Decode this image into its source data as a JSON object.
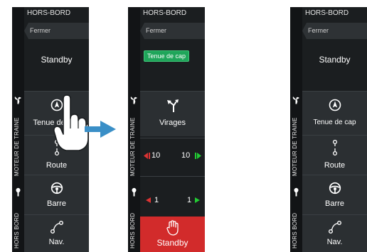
{
  "colors": {
    "accent_green": "#1fa55a",
    "stop_red": "#d22b2b",
    "arrow_blue": "#3a8fc7"
  },
  "panel1": {
    "title": "HORS-BORD",
    "close_label": "Fermer",
    "mode": "Standby",
    "rail_sections": [
      "MOTEUR DE TRAINE",
      "HORS BORD"
    ],
    "tiles": [
      {
        "label": "Tenue de cap",
        "icon": "compass-icon"
      },
      {
        "label": "Route",
        "icon": "route-icon"
      },
      {
        "label": "Barre",
        "icon": "steering-wheel-icon"
      },
      {
        "label": "Nav.",
        "icon": "nav-icon"
      }
    ],
    "overlay_icon": "pointing-hand-icon"
  },
  "panel2": {
    "title": "HORS-BORD",
    "close_label": "Fermer",
    "active_mode": "Tenue de cap",
    "rail_sections": [
      "MOTEUR DE TRAINE",
      "HORS BORD"
    ],
    "turns_label": "Virages",
    "turns_icon": "turn-arrows-icon",
    "port_10": "10",
    "stbd_10": "10",
    "port_1": "1",
    "stbd_1": "1",
    "standby_label": "Standby",
    "standby_icon": "hand-stop-icon"
  },
  "panel3": {
    "title": "HORS-BORD",
    "close_label": "Fermer",
    "mode": "Standby",
    "rail_sections": [
      "MOTEUR DE TRAINE",
      "HORS BORD"
    ],
    "tiles": [
      {
        "label": "Tenue de cap",
        "icon": "compass-icon"
      },
      {
        "label": "Route",
        "icon": "route-icon"
      },
      {
        "label": "Barre",
        "icon": "steering-wheel-icon"
      },
      {
        "label": "Nav.",
        "icon": "nav-icon"
      }
    ]
  },
  "transition_icon": "right-arrow-icon"
}
